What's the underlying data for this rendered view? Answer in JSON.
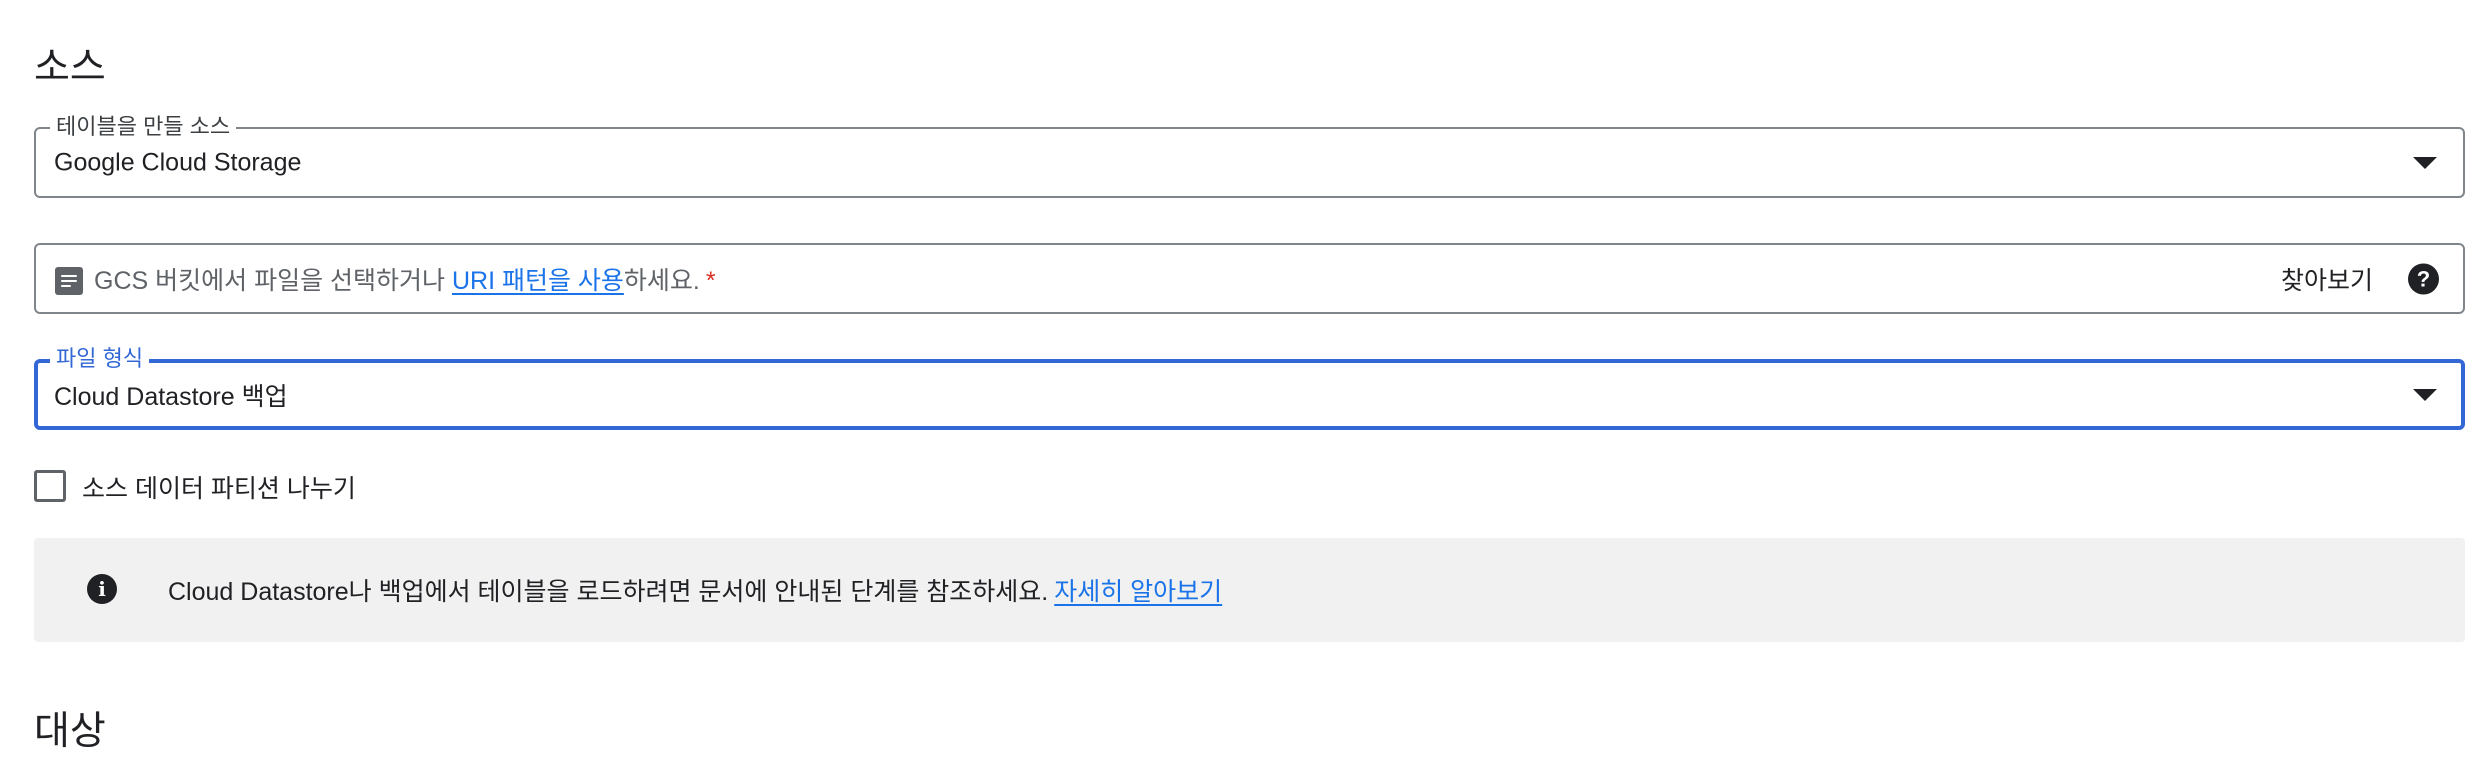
{
  "sections": {
    "source_title": "소스",
    "target_title": "대상"
  },
  "source_select": {
    "label": "테이블을 만들 소스",
    "value": "Google Cloud Storage"
  },
  "gcs_field": {
    "prefix": "GCS 버킷에서 파일을 선택하거나 ",
    "link": "URI 패턴을 사용",
    "suffix": "하세요.",
    "required_mark": "*",
    "browse_label": "찾아보기",
    "help_glyph": "?"
  },
  "format_select": {
    "label": "파일 형식",
    "value": "Cloud Datastore 백업"
  },
  "partition_checkbox": {
    "label": "소스 데이터 파티션 나누기",
    "checked": false
  },
  "info_banner": {
    "icon_glyph": "i",
    "text": "Cloud Datastore나 백업에서 테이블을 로드하려면 문서에 안내된 단계를 참조하세요.",
    "link": "자세히 알아보기"
  },
  "colors": {
    "accent": "#3367d6",
    "link": "#1a73e8",
    "required": "#d93025",
    "banner_bg": "#f1f1f1"
  }
}
